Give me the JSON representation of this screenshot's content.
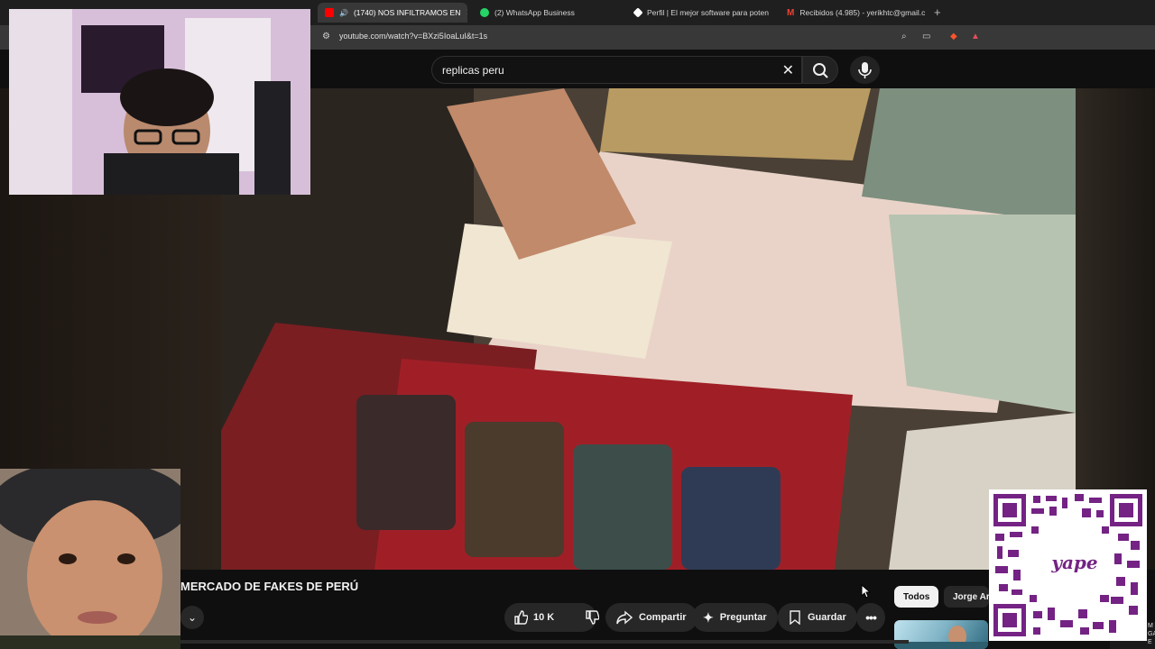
{
  "browser": {
    "tabs": [
      {
        "title": "(1740) NOS INFILTRAMOS EN",
        "active": true,
        "favicon_color": "#ff0000"
      },
      {
        "title": "(2) WhatsApp Business",
        "active": false,
        "favicon_color": "#25d366"
      },
      {
        "title": "Perfil | El mejor software para poten",
        "active": false,
        "favicon_color": "#ffffff"
      },
      {
        "title": "Recibidos (4.985) - yerikhtc@gmail.c",
        "active": false,
        "favicon_color": "#ea4335"
      }
    ],
    "url": "youtube.com/watch?v=BXzi5IoaLuI&t=1s"
  },
  "youtube": {
    "search_query": "replicas peru",
    "video_title": "MERCADO DE FAKES DE PERÚ",
    "likes": "10 K",
    "share_label": "Compartir",
    "ask_label": "Preguntar",
    "save_label": "Guardar",
    "chips": [
      "Todos",
      "Jorge Ar"
    ]
  },
  "qr": {
    "brand": "yape"
  },
  "edge_text": [
    "M",
    "GASTAR E"
  ],
  "colors": {
    "accent": "#742384",
    "youtube_red": "#ff0000",
    "dark_bg": "#0f0f0f"
  }
}
